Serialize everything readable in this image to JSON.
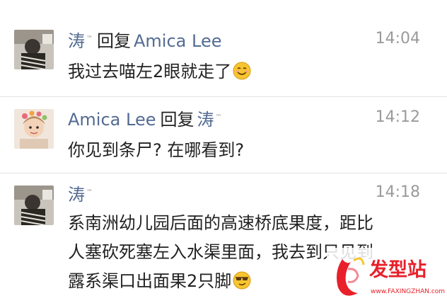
{
  "messages": [
    {
      "user": "涛",
      "user_badge": "™",
      "reply_label": "回复",
      "reply_target": "Amica Lee",
      "time": "14:04",
      "lines": [
        "我过去喵左2眼就走了"
      ],
      "emoji": "smile-emoji"
    },
    {
      "user": "Amica Lee",
      "reply_label": "回复",
      "reply_target": "涛",
      "reply_target_badge": "™",
      "time": "14:12",
      "lines": [
        "你见到条尸? 在哪看到?"
      ]
    },
    {
      "user": "涛",
      "user_badge": "™",
      "time": "14:18",
      "lines": [
        "系南洲幼儿园后面的高速桥底果度，距比",
        "人塞砍死塞左入水渠里面，我去到只见到",
        "露系渠口出面果2只脚"
      ],
      "emoji": "sunglasses-emoji"
    }
  ],
  "watermark": {
    "brand": "发型站",
    "url": "www.FAXINGZHAN.com"
  },
  "colors": {
    "username": "#536b92",
    "text": "#222222",
    "time": "#9a9a9a",
    "brand_red": "#e8202a"
  }
}
